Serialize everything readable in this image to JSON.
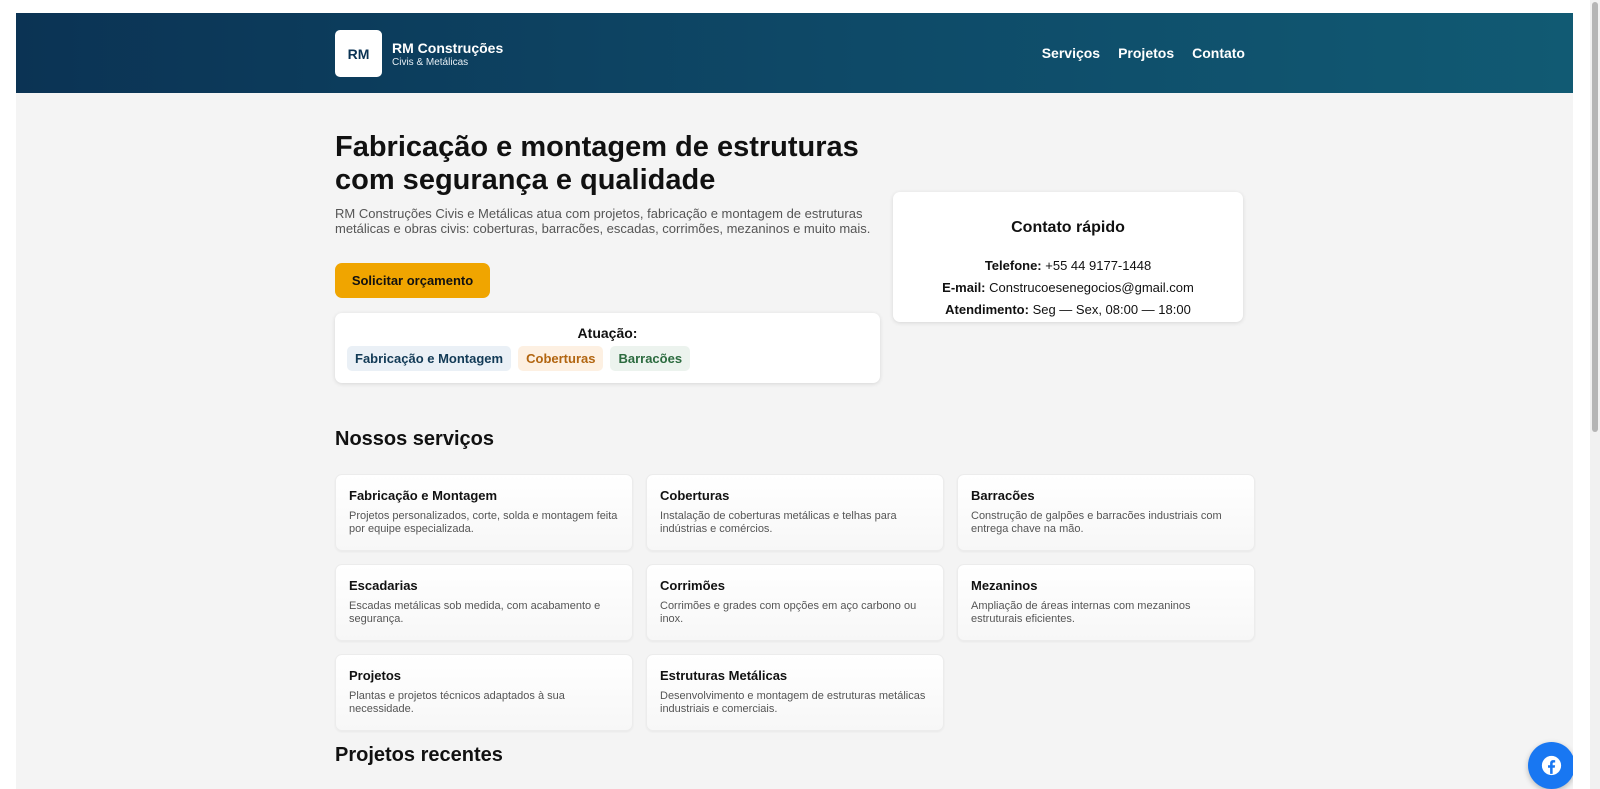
{
  "brand": {
    "logo_text": "RM",
    "name": "RM Construções",
    "tagline": "Civis & Metálicas"
  },
  "nav": {
    "items": [
      "Serviços",
      "Projetos",
      "Contato"
    ]
  },
  "hero": {
    "title_line1": "Fabricação e montagem de estruturas",
    "title_line2": "com segurança e qualidade",
    "description": "RM Construções Civis e Metálicas atua com projetos, fabricação e montagem de estruturas metálicas e obras civis: coberturas, barracões, escadas, corrimões, mezaninos e muito mais.",
    "cta_label": "Solicitar orçamento"
  },
  "atuacao": {
    "title": "Atuação:",
    "tags": [
      "Fabricação e Montagem",
      "Coberturas",
      "Barracões"
    ]
  },
  "contact": {
    "title": "Contato rápido",
    "phone_label": "Telefone:",
    "phone": "+55 44 9177-1448",
    "email_label": "E-mail:",
    "email": "Construcoesenegocios@gmail.com",
    "hours_label": "Atendimento:",
    "hours": "Seg — Sex, 08:00 — 18:00"
  },
  "services": {
    "title": "Nossos serviços",
    "items": [
      {
        "title": "Fabricação e Montagem",
        "desc": "Projetos personalizados, corte, solda e montagem feita por equipe especializada."
      },
      {
        "title": "Coberturas",
        "desc": "Instalação de coberturas metálicas e telhas para indústrias e comércios."
      },
      {
        "title": "Barracões",
        "desc": "Construção de galpões e barracões industriais com entrega chave na mão."
      },
      {
        "title": "Escadarias",
        "desc": "Escadas metálicas sob medida, com acabamento e segurança."
      },
      {
        "title": "Corrimões",
        "desc": "Corrimões e grades com opções em aço carbono ou inox."
      },
      {
        "title": "Mezaninos",
        "desc": "Ampliação de áreas internas com mezaninos estruturais eficientes."
      },
      {
        "title": "Projetos",
        "desc": "Plantas e projetos técnicos adaptados à sua necessidade."
      },
      {
        "title": "Estruturas Metálicas",
        "desc": "Desenvolvimento e montagem de estruturas metálicas industriais e comerciais."
      }
    ]
  },
  "projects": {
    "title": "Projetos recentes"
  },
  "floating": {
    "icon": "facebook-icon"
  },
  "colors": {
    "header_start": "#0b3354",
    "header_end": "#115a73",
    "accent": "#f0a500",
    "facebook": "#1877f2"
  }
}
